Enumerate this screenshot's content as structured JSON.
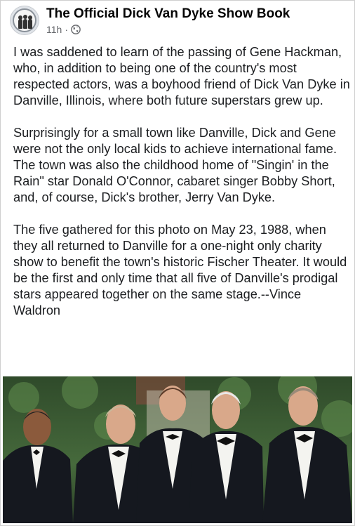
{
  "post": {
    "page_name": "The Official Dick Van Dyke Show Book",
    "timestamp": "11h",
    "separator": "·",
    "privacy_icon": "globe-icon",
    "avatar_icon": "page-avatar",
    "paragraphs": [
      "I was saddened to learn of the passing of Gene Hackman, who, in addition to being one of the country's most respected actors, was a boyhood friend of Dick Van Dyke in Danville, Illinois, where both future superstars grew up.",
      "Surprisingly for a small town like Danville, Dick and Gene were not the only local kids to achieve international fame. The town was also the childhood home of \"Singin' in the Rain\" star Donald O'Connor, cabaret singer Bobby Short, and, of course, Dick's brother, Jerry Van Dyke.",
      "The five gathered for this photo on May 23, 1988, when they all returned to Danville for a one-night only charity show to benefit the town's historic Fischer Theater. It would be the first and only time that all five of Danville's prodigal stars appeared together on the same stage.--Vince Waldron"
    ]
  },
  "colors": {
    "text": "#1c1e21",
    "meta": "#65676b",
    "tux": "#15181f",
    "foliage": "#3d5a36"
  }
}
